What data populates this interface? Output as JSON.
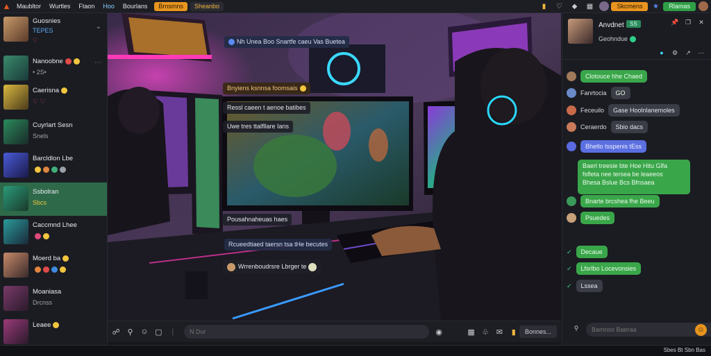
{
  "topbar": {
    "nav": [
      "Maubltor",
      "Wurtles",
      "Ftaon",
      "Hoo",
      "Bourlans"
    ],
    "active_pill": "Brnsmns",
    "pill2": "Sheanbo",
    "right_button_orange": "Skcmens",
    "right_button_green": "Rlamas"
  },
  "sidebar": {
    "contacts": [
      {
        "name": "Guosnies",
        "sub": "TEPES",
        "subicon": "♡"
      },
      {
        "name": "Nanoobne",
        "sub": "• 2S•",
        "subicon": ""
      },
      {
        "name": "Caerisna",
        "sub": "♡ ♡",
        "subicon": ""
      },
      {
        "name": "Cuyrlart Sesn",
        "sub": "Snels",
        "subicon": ""
      },
      {
        "name": "Barcldlon Lbe",
        "sub": "",
        "subicon": ""
      },
      {
        "name": "Ssbolran",
        "sub": "Sbcs",
        "subicon": ""
      },
      {
        "name": "Caccmnd Lhee",
        "sub": "",
        "subicon": ""
      },
      {
        "name": "Moerd ba",
        "sub": "",
        "subicon": ""
      },
      {
        "name": "Moaniasa",
        "sub": "Drcnss",
        "subicon": ""
      },
      {
        "name": "Leaee",
        "sub": "",
        "subicon": ""
      }
    ]
  },
  "scene": {
    "messages": [
      "Nh Unea Boo Snartfe caeu Vas Buetea",
      "Bnyiens ksnnsa foomsais",
      "Ressl caeen t aenoe batibes",
      "Uwe tres ttalfllare Ians",
      "Pousahnaheuas haes",
      "Rcueedtiaed taersn tsa tHe becutes",
      "Wrrenboudrsre Lbrger te"
    ]
  },
  "inputbar": {
    "placeholder": "N Dur",
    "send_label": "Bonnes..."
  },
  "chat": {
    "title": "Anvdnet",
    "tag": "SS",
    "status": "Geohndue",
    "messages": [
      {
        "sender": "",
        "text": "Clotouce hhe Chaed",
        "style": "green"
      },
      {
        "sender": "Fanrtocia",
        "text": "GO",
        "style": "green"
      },
      {
        "sender": "Feceuilo",
        "text": "Gase Hoolnlanemoles",
        "style": "gray"
      },
      {
        "sender": "Ceraerdo",
        "text": "Sbio dacs",
        "style": "gray"
      },
      {
        "sender": "",
        "text": "Bhetlo tsspenis tEss",
        "style": "blue"
      },
      {
        "sender": "",
        "text": "Bnarte brcshea fhe Beeu",
        "style": "green"
      },
      {
        "sender": "",
        "text": "Psuedes",
        "style": "green"
      },
      {
        "sender": "",
        "text": "Decaue",
        "style": "green"
      },
      {
        "sender": "",
        "text": "Lfsrlbo Locevonsies",
        "style": "green"
      },
      {
        "sender": "",
        "text": "Lssea",
        "style": "gray"
      }
    ],
    "big_message": "Baerl treesie bte Hoe Hitu Glfa\nfsfleta nee tersea be leaeeos\nBhesa Bslue Bcs Bfnsaea",
    "input_placeholder": "Bamnso Baeraa"
  },
  "statusbar": {
    "text": "Sbes Bt Sbn Bas"
  },
  "colors": {
    "accent_orange": "#e8941e",
    "accent_green": "#3aa64a",
    "active_contact": "#2e6a4a",
    "bubble_blue": "#5b6fe0"
  }
}
